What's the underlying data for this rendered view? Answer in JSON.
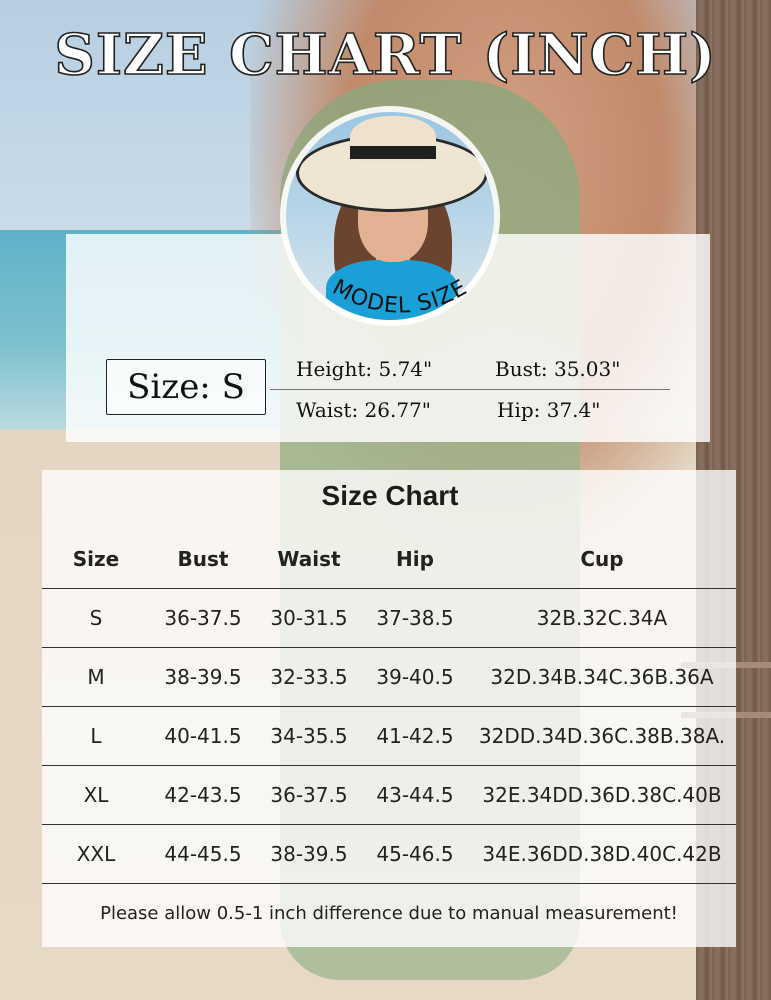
{
  "title": "SIZE CHART (INCH)",
  "model": {
    "caption": "MODEL SIZE",
    "size_label": "Size: S",
    "height": "Height: 5.74\"",
    "bust": "Bust: 35.03\"",
    "waist": "Waist: 26.77\"",
    "hip": "Hip: 37.4\""
  },
  "chart": {
    "title": "Size Chart",
    "headers": [
      "Size",
      "Bust",
      "Waist",
      "Hip",
      "Cup"
    ],
    "rows": [
      [
        "S",
        "36-37.5",
        "30-31.5",
        "37-38.5",
        "32B.32C.34A"
      ],
      [
        "M",
        "38-39.5",
        "32-33.5",
        "39-40.5",
        "32D.34B.34C.36B.36A"
      ],
      [
        "L",
        "40-41.5",
        "34-35.5",
        "41-42.5",
        "32DD.34D.36C.38B.38A."
      ],
      [
        "XL",
        "42-43.5",
        "36-37.5",
        "43-44.5",
        "32E.34DD.36D.38C.40B"
      ],
      [
        "XXL",
        "44-45.5",
        "38-39.5",
        "45-46.5",
        "34E.36DD.38D.40C.42B"
      ]
    ],
    "note": "Please allow 0.5-1 inch difference due to manual measurement!"
  }
}
